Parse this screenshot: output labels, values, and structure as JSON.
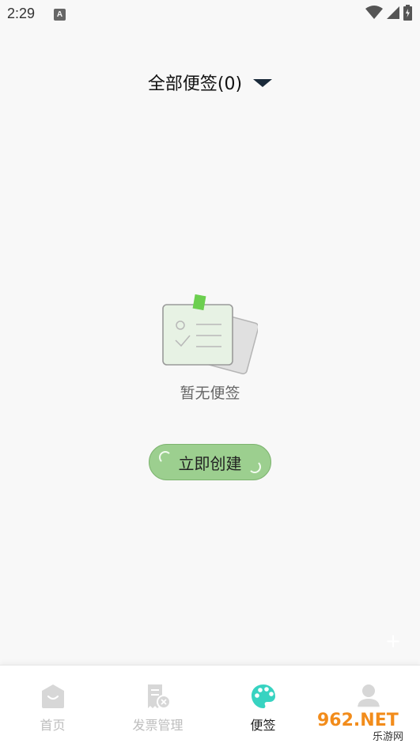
{
  "status": {
    "time": "2:29",
    "notification_glyph": "A"
  },
  "header": {
    "title": "全部便签(0)"
  },
  "empty": {
    "message": "暂无便签"
  },
  "create_button": {
    "label": "立即创建"
  },
  "tabs": [
    {
      "label": "首页",
      "icon": "home-icon",
      "active": false
    },
    {
      "label": "发票管理",
      "icon": "invoice-icon",
      "active": false
    },
    {
      "label": "便签",
      "icon": "palette-icon",
      "active": true
    },
    {
      "label": "",
      "icon": "user-icon",
      "active": false
    }
  ],
  "watermark": {
    "text": "962.NET",
    "subtext": "乐游网"
  },
  "colors": {
    "accent": "#37d3c1",
    "button": "#9ccf8f",
    "tab_inactive": "#bdbdbd"
  }
}
